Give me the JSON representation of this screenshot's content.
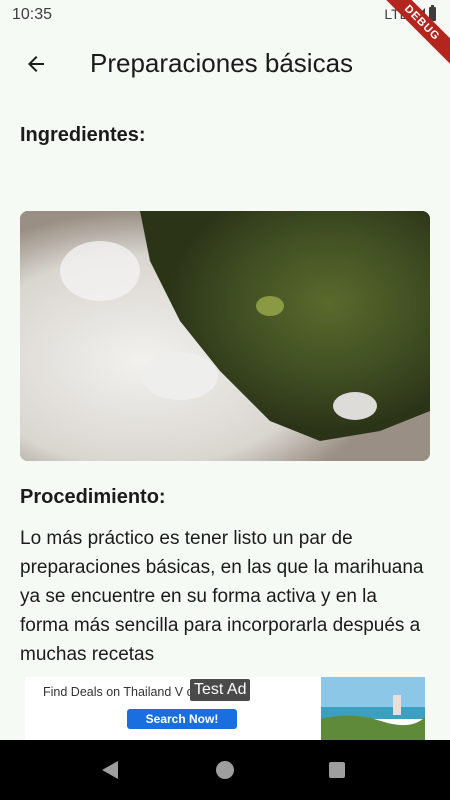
{
  "status_bar": {
    "time": "10:35",
    "network": "LTE"
  },
  "debug_banner": "DEBUG",
  "app_bar": {
    "title": "Preparaciones básicas",
    "back_icon": "arrow-back-icon"
  },
  "content": {
    "ingredients_heading": "Ingredientes:",
    "procedure_heading": "Procedimiento:",
    "procedure_text": "Lo más práctico es tener listo un par de preparaciones básicas, en las que la marihuana ya se encuentre en su forma activa y en la forma más sencilla para incorporarla después a muchas recetas"
  },
  "ad": {
    "headline": "Find Deals on Thailand V     ckages.",
    "cta": "Search Now!",
    "label": "Test Ad"
  },
  "colors": {
    "background": "#f5faf5",
    "debug": "#b3261e",
    "ad_cta": "#1a6fe0"
  }
}
